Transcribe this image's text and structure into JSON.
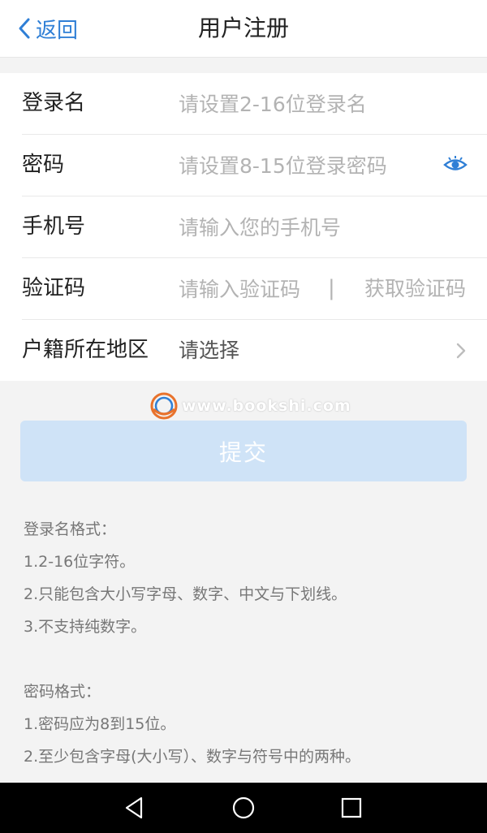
{
  "header": {
    "back_label": "返回",
    "title": "用户注册"
  },
  "form": {
    "login_name": {
      "label": "登录名",
      "placeholder": "请设置2-16位登录名"
    },
    "password": {
      "label": "密码",
      "placeholder": "请设置8-15位登录密码"
    },
    "phone": {
      "label": "手机号",
      "placeholder": "请输入您的手机号"
    },
    "code": {
      "label": "验证码",
      "placeholder": "请输入验证码",
      "separator": "|",
      "get_code_label": "获取验证码"
    },
    "region": {
      "label": "户籍所在地区",
      "value": "请选择"
    }
  },
  "watermark": {
    "text": "www.bookshi.com"
  },
  "submit_label": "提交",
  "notes": {
    "login_title": "登录名格式：",
    "login_rules": [
      "1.2-16位字符。",
      "2.只能包含大小写字母、数字、中文与下划线。",
      "3.不支持纯数字。"
    ],
    "password_title": "密码格式：",
    "password_rules": [
      "1.密码应为8到15位。",
      "2.至少包含字母(大小写）、数字与符号中的两种。"
    ]
  },
  "colors": {
    "accent": "#2f7fd6",
    "submit_bg": "#cfe3f7",
    "placeholder": "#b3b3b3"
  },
  "icons": {
    "back": "chevron-left-icon",
    "eye": "eye-icon",
    "region_arrow": "chevron-right-icon",
    "nav_back": "triangle-back-icon",
    "nav_home": "circle-home-icon",
    "nav_recent": "square-recent-icon"
  }
}
